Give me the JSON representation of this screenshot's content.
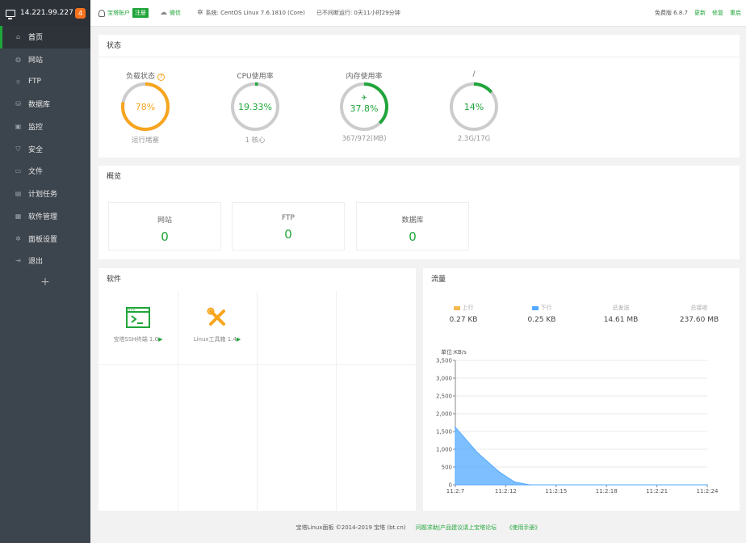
{
  "sidebar": {
    "ip": "14.221.99.227",
    "badge": "4",
    "items": [
      {
        "label": "首页",
        "icon": "home-icon",
        "glyph": "⌂"
      },
      {
        "label": "网站",
        "icon": "globe-icon",
        "glyph": "◍"
      },
      {
        "label": "FTP",
        "icon": "ftp-icon",
        "glyph": "⌾"
      },
      {
        "label": "数据库",
        "icon": "database-icon",
        "glyph": "⛁"
      },
      {
        "label": "监控",
        "icon": "monitor-icon",
        "glyph": "▣"
      },
      {
        "label": "安全",
        "icon": "shield-icon",
        "glyph": "⛉"
      },
      {
        "label": "文件",
        "icon": "folder-icon",
        "glyph": "▭"
      },
      {
        "label": "计划任务",
        "icon": "calendar-icon",
        "glyph": "▤"
      },
      {
        "label": "软件管理",
        "icon": "apps-icon",
        "glyph": "▦"
      },
      {
        "label": "面板设置",
        "icon": "gear-icon",
        "glyph": "✲"
      },
      {
        "label": "退出",
        "icon": "logout-icon",
        "glyph": "⇥"
      }
    ],
    "add_label": "+"
  },
  "topbar": {
    "account": "宝塔账户",
    "register": "注册",
    "wechat": "微信",
    "system_label": "系统:",
    "system_value": "CentOS Linux 7.6.1810 (Core)",
    "uptime": "已不间断运行: 0天11小时29分钟",
    "version": "免费版 6.8.7",
    "update": "更新",
    "repair": "修复",
    "restart": "重启"
  },
  "status": {
    "title": "状态",
    "gauges": [
      {
        "label": "负载状态",
        "value": "78%",
        "percent": 78,
        "color": "#f7a51d",
        "sub": "运行堵塞",
        "help": "?"
      },
      {
        "label": "CPU使用率",
        "value": "19.33%",
        "percent": 2,
        "color": "#20a53a",
        "sub": "1 核心"
      },
      {
        "label": "内存使用率",
        "value": "37.8%",
        "percent": 37.8,
        "color": "#20a53a",
        "sub": "367/972(MB)",
        "rocket": true
      },
      {
        "label": "/",
        "value": "14%",
        "percent": 14,
        "color": "#20a53a",
        "sub": "2.3G/17G"
      }
    ]
  },
  "overview": {
    "title": "概览",
    "boxes": [
      {
        "label": "网站",
        "value": "0"
      },
      {
        "label": "FTP",
        "value": "0"
      },
      {
        "label": "数据库",
        "value": "0"
      }
    ]
  },
  "software": {
    "title": "软件",
    "items": [
      {
        "label": "宝塔SSH终端 1.0",
        "icon": "terminal-icon",
        "arrow": "▶"
      },
      {
        "label": "Linux工具箱 1.4",
        "icon": "tools-icon",
        "arrow": "▶"
      }
    ]
  },
  "traffic": {
    "title": "流量",
    "stats": [
      {
        "label": "上行",
        "value": "0.27 KB",
        "color": "#f7b851"
      },
      {
        "label": "下行",
        "value": "0.25 KB",
        "color": "#52a9ff"
      },
      {
        "label": "总发送",
        "value": "14.61 MB"
      },
      {
        "label": "总接收",
        "value": "237.60 MB"
      }
    ]
  },
  "chart_data": {
    "type": "area",
    "ylabel": "单位:KB/s",
    "ylim": [
      0,
      3500
    ],
    "yticks": [
      "0",
      "500",
      "1,000",
      "1,500",
      "2,000",
      "2,500",
      "3,000",
      "3,500"
    ],
    "xticks": [
      "11:2:7",
      "11:2:12",
      "11:2:15",
      "11:2:18",
      "11:2:21",
      "11:2:24"
    ],
    "series": [
      {
        "color": "#52a9ff",
        "points": [
          [
            0,
            1620
          ],
          [
            1.5,
            900
          ],
          [
            3,
            350
          ],
          [
            4,
            80
          ],
          [
            5,
            0
          ],
          [
            17,
            0
          ]
        ]
      }
    ],
    "xlim": [
      0,
      17
    ]
  },
  "footer": {
    "copyright": "宝塔Linux面板 ©2014-2019 宝塔 (bt.cn)",
    "forum": "问题求助|产品建议请上宝塔论坛",
    "manual": "《使用手册》"
  }
}
